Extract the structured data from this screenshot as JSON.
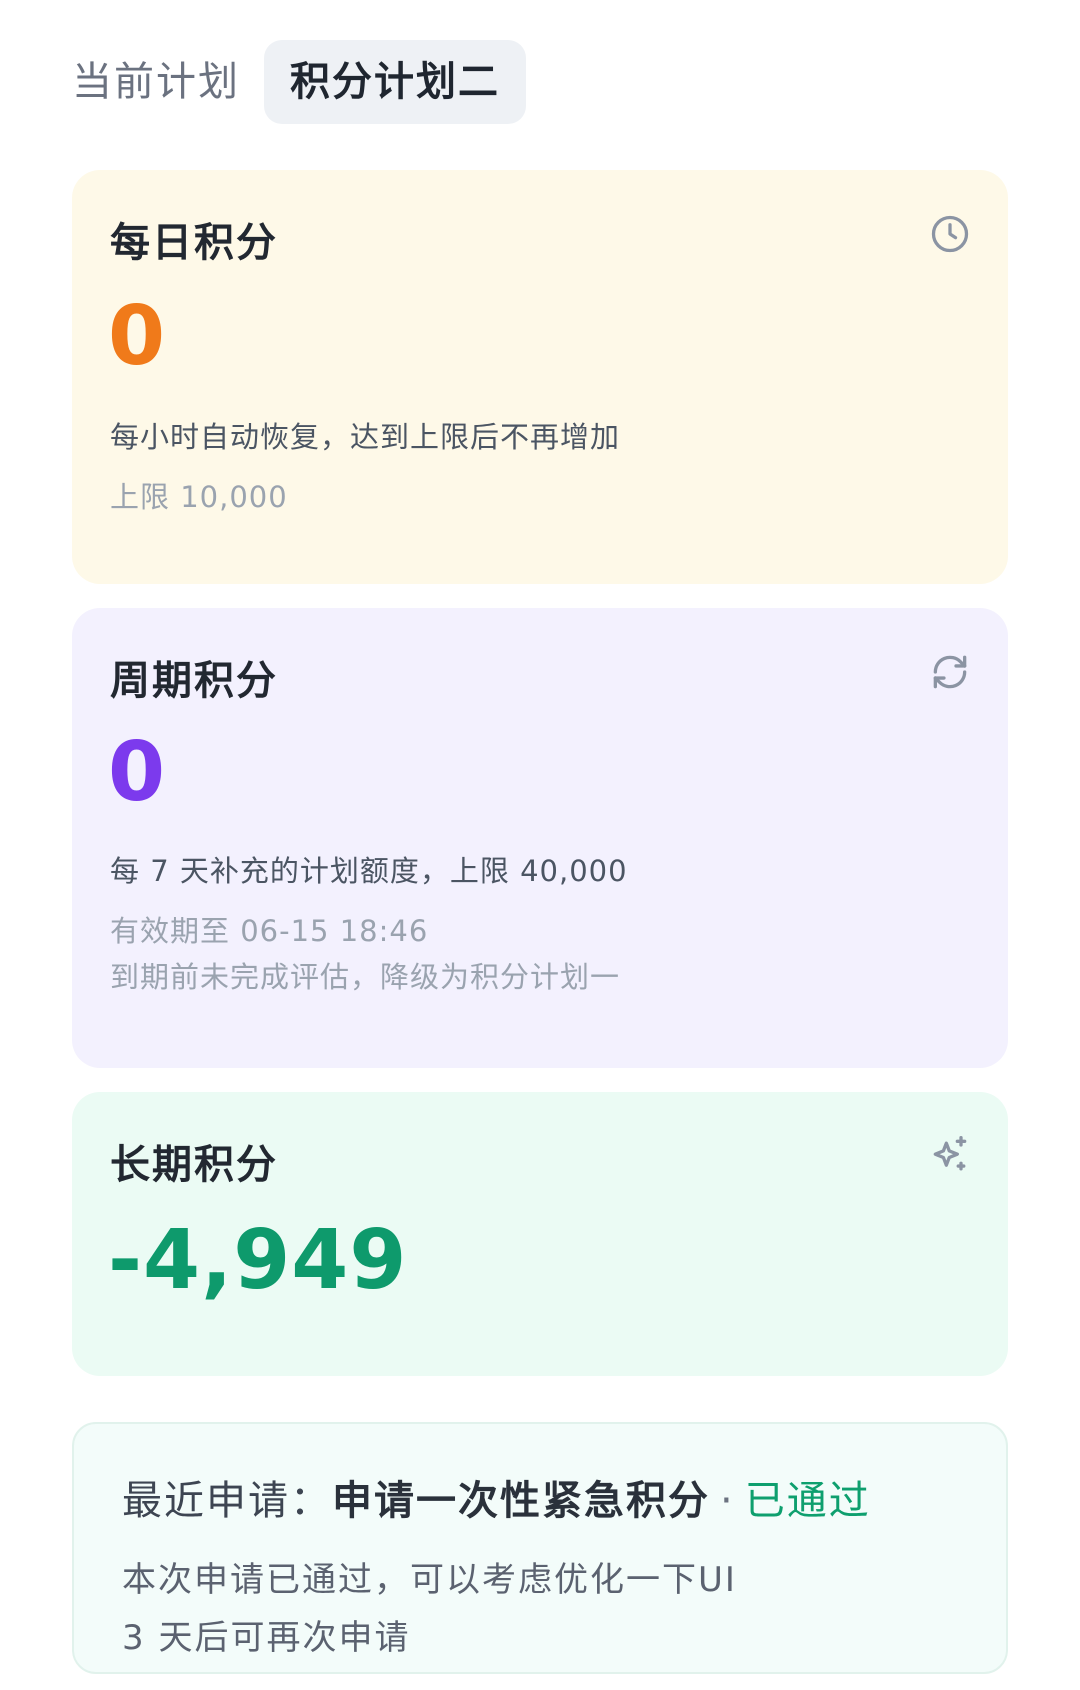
{
  "tabs": [
    {
      "label": "当前计划",
      "active": false
    },
    {
      "label": "积分计划二",
      "active": true
    }
  ],
  "daily": {
    "title": "每日积分",
    "icon": "clock-icon",
    "value": "0",
    "value_color": "#f07a1a",
    "description": "每小时自动恢复，达到上限后不再增加",
    "limit": "上限 10,000",
    "bg_color": "#fef9e8"
  },
  "cycle": {
    "title": "周期积分",
    "icon": "refresh-icon",
    "value": "0",
    "value_color": "#7c3aed",
    "description": "每 7 天补充的计划额度，上限 40,000",
    "expiry": "有效期至 06-15 18:46",
    "warning": "到期前未完成评估，降级为积分计划一",
    "bg_color": "#f3f1fe"
  },
  "long_term": {
    "title": "长期积分",
    "icon": "sparkles-icon",
    "value": "-4,949",
    "value_color": "#0e9a6c",
    "bg_color": "#ebfbf4"
  },
  "request": {
    "label": "最近申请：",
    "title": "申请一次性紧急积分",
    "separator": "·",
    "status": "已通过",
    "status_color": "#0e9f6e",
    "message": "本次申请已通过，可以考虑优化一下UI",
    "cooldown": "3 天后可再次申请"
  }
}
